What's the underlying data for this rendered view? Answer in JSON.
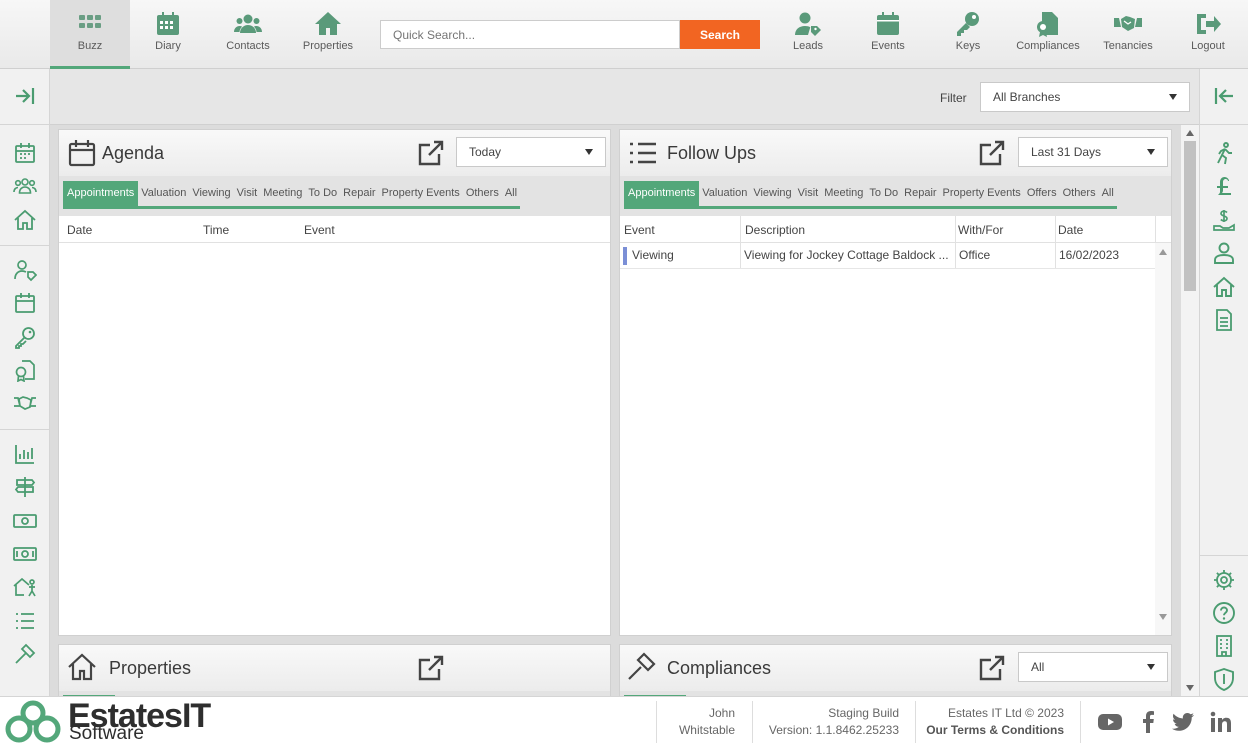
{
  "topnav": {
    "items": [
      {
        "label": "Buzz",
        "icon": "grid-icon",
        "active": true
      },
      {
        "label": "Diary",
        "icon": "calendar-icon"
      },
      {
        "label": "Contacts",
        "icon": "people-icon"
      },
      {
        "label": "Properties",
        "icon": "house-icon"
      },
      {
        "label": "Leads",
        "icon": "person-tag-icon"
      },
      {
        "label": "Events",
        "icon": "calendar-icon"
      },
      {
        "label": "Keys",
        "icon": "key-icon"
      },
      {
        "label": "Compliances",
        "icon": "certificate-icon"
      },
      {
        "label": "Tenancies",
        "icon": "handshake-icon"
      },
      {
        "label": "Logout",
        "icon": "logout-icon"
      }
    ],
    "search_placeholder": "Quick Search...",
    "search_button": "Search"
  },
  "filter": {
    "label": "Filter",
    "value": "All Branches"
  },
  "agenda": {
    "title": "Agenda",
    "range": "Today",
    "tabs": [
      "Appointments",
      "Valuation",
      "Viewing",
      "Visit",
      "Meeting",
      "To Do",
      "Repair",
      "Property Events",
      "Others",
      "All"
    ],
    "columns": [
      "Date",
      "Time",
      "Event"
    ]
  },
  "followups": {
    "title": "Follow Ups",
    "range": "Last 31 Days",
    "tabs": [
      "Appointments",
      "Valuation",
      "Viewing",
      "Visit",
      "Meeting",
      "To Do",
      "Repair",
      "Property Events",
      "Offers",
      "Others",
      "All"
    ],
    "columns": [
      "Event",
      "Description",
      "With/For",
      "Date"
    ],
    "rows": [
      {
        "event": "Viewing",
        "description": "Viewing for Jockey Cottage Baldock ...",
        "with_for": "Office",
        "date": "16/02/2023"
      }
    ]
  },
  "properties": {
    "title": "Properties"
  },
  "compliances": {
    "title": "Compliances",
    "range": "All"
  },
  "footer": {
    "brand": "EstatesIT",
    "brand_sub": "Software",
    "user_first": "John",
    "user_branch": "Whitstable",
    "build_label": "Staging Build",
    "version": "Version: 1.1.8462.25233",
    "copyright": "Estates IT Ltd © 2023",
    "terms": "Our Terms & Conditions"
  },
  "colors": {
    "accent": "#53a77a",
    "search_button": "#f26522"
  }
}
